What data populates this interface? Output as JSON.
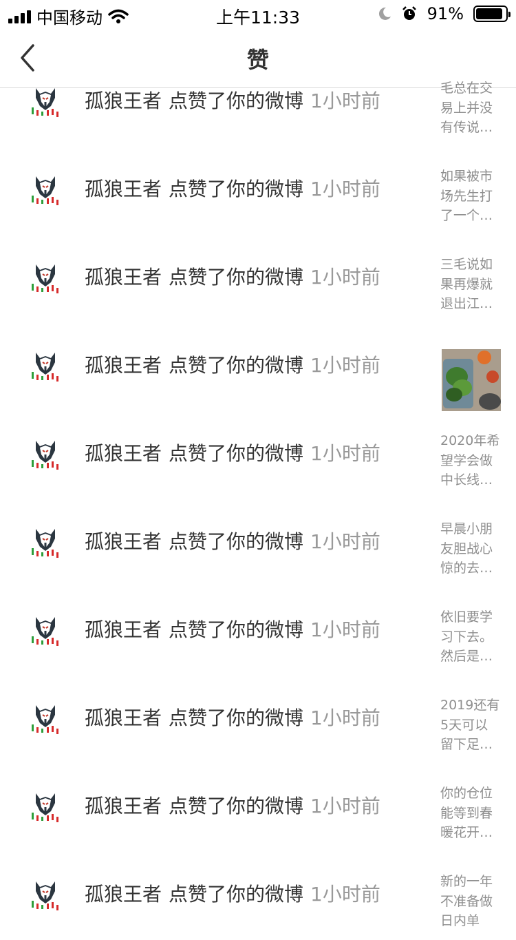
{
  "status_bar": {
    "carrier": "中国移动",
    "time": "上午11:33",
    "battery_text": "91%",
    "battery_level": 0.91,
    "icons": [
      "signal-icon",
      "wifi-icon",
      "moon-icon",
      "alarm-icon",
      "battery-icon"
    ]
  },
  "nav": {
    "title": "赞",
    "back_icon": "chevron-left-icon"
  },
  "items": [
    {
      "name": "孤狼王者",
      "action": "点赞了你的微博",
      "time": "1小时前",
      "preview": [
        "毛总在交",
        "易上并没",
        "有传说…"
      ]
    },
    {
      "name": "孤狼王者",
      "action": "点赞了你的微博",
      "time": "1小时前",
      "preview": [
        "如果被市",
        "场先生打",
        "了一个…"
      ]
    },
    {
      "name": "孤狼王者",
      "action": "点赞了你的微博",
      "time": "1小时前",
      "preview": [
        "三毛说如",
        "果再爆就",
        "退出江…"
      ]
    },
    {
      "name": "孤狼王者",
      "action": "点赞了你的微博",
      "time": "1小时前",
      "preview": [],
      "thumbnail": "food-photo"
    },
    {
      "name": "孤狼王者",
      "action": "点赞了你的微博",
      "time": "1小时前",
      "preview": [
        "2020年希",
        "望学会做",
        "中长线…"
      ]
    },
    {
      "name": "孤狼王者",
      "action": "点赞了你的微博",
      "time": "1小时前",
      "preview": [
        "早晨小朋",
        "友胆战心",
        "惊的去…"
      ]
    },
    {
      "name": "孤狼王者",
      "action": "点赞了你的微博",
      "time": "1小时前",
      "preview": [
        "依旧要学",
        "习下去。",
        "然后是…"
      ]
    },
    {
      "name": "孤狼王者",
      "action": "点赞了你的微博",
      "time": "1小时前",
      "preview": [
        "2019还有",
        "5天可以",
        "留下足…"
      ]
    },
    {
      "name": "孤狼王者",
      "action": "点赞了你的微博",
      "time": "1小时前",
      "preview": [
        "你的仓位",
        "能等到春",
        "暖花开…"
      ]
    },
    {
      "name": "孤狼王者",
      "action": "点赞了你的微博",
      "time": "1小时前",
      "preview": [
        "新的一年",
        "不准备做",
        "日内单"
      ]
    }
  ]
}
